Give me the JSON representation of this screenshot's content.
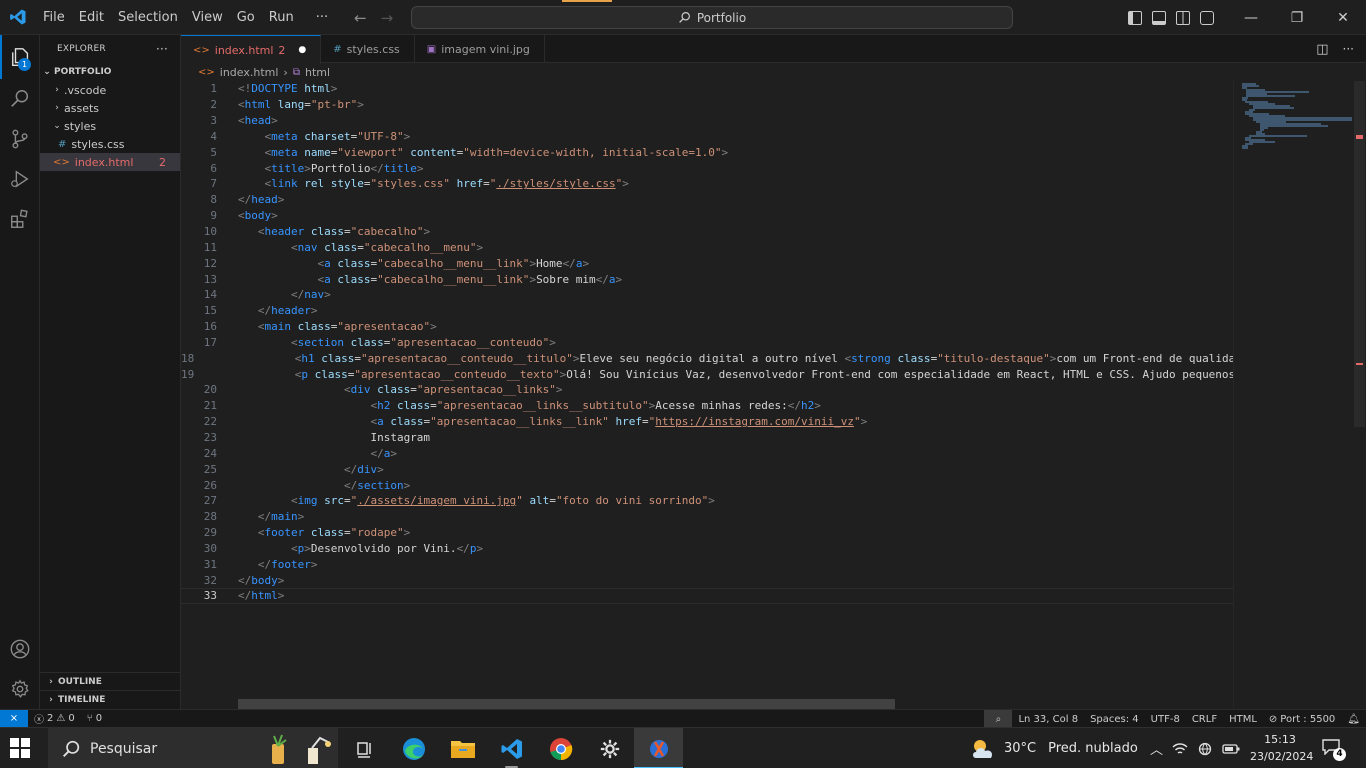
{
  "titlebar": {
    "menu": [
      "File",
      "Edit",
      "Selection",
      "View",
      "Go",
      "Run"
    ],
    "more": "···",
    "search_text": "Portfolio"
  },
  "activity": {
    "explorer_badge": "1"
  },
  "sidebar": {
    "title": "EXPLORER",
    "more": "···",
    "root": "PORTFOLIO",
    "items": [
      {
        "label": ".vscode",
        "type": "folder",
        "expanded": false,
        "indent": 1
      },
      {
        "label": "assets",
        "type": "folder",
        "expanded": false,
        "indent": 1
      },
      {
        "label": "styles",
        "type": "folder",
        "expanded": true,
        "indent": 1
      },
      {
        "label": "styles.css",
        "type": "css",
        "indent": 2
      },
      {
        "label": "index.html",
        "type": "html",
        "indent": 1,
        "selected": true,
        "errors": "2"
      }
    ],
    "outline": "OUTLINE",
    "timeline": "TIMELINE"
  },
  "tabs": [
    {
      "label": "index.html",
      "count": "2",
      "active": true,
      "modified": true,
      "icon": "html"
    },
    {
      "label": "styles.css",
      "active": false,
      "icon": "css"
    },
    {
      "label": "imagem vini.jpg",
      "active": false,
      "icon": "image"
    }
  ],
  "breadcrumb": {
    "file": "index.html",
    "symbol": "html"
  },
  "code_lines": [
    [
      [
        "tb",
        "<!"
      ],
      [
        "t",
        "DOCTYPE"
      ],
      [
        "x",
        " "
      ],
      [
        "a",
        "html"
      ],
      [
        "tb",
        ">"
      ]
    ],
    [
      [
        "tb",
        "<"
      ],
      [
        "t",
        "html"
      ],
      [
        "x",
        " "
      ],
      [
        "a",
        "lang"
      ],
      [
        "x",
        "="
      ],
      [
        "s",
        "\"pt-br\""
      ],
      [
        "tb",
        ">"
      ]
    ],
    [
      [
        "tb",
        "<"
      ],
      [
        "t",
        "head"
      ],
      [
        "tb",
        ">"
      ]
    ],
    [
      [
        "x",
        "    "
      ],
      [
        "tb",
        "<"
      ],
      [
        "t",
        "meta"
      ],
      [
        "x",
        " "
      ],
      [
        "a",
        "charset"
      ],
      [
        "x",
        "="
      ],
      [
        "s",
        "\"UTF-8\""
      ],
      [
        "tb",
        ">"
      ]
    ],
    [
      [
        "x",
        "    "
      ],
      [
        "tb",
        "<"
      ],
      [
        "t",
        "meta"
      ],
      [
        "x",
        " "
      ],
      [
        "a",
        "name"
      ],
      [
        "x",
        "="
      ],
      [
        "s",
        "\"viewport\""
      ],
      [
        "x",
        " "
      ],
      [
        "a",
        "content"
      ],
      [
        "x",
        "="
      ],
      [
        "s",
        "\"width=device-width, initial-scale=1.0\""
      ],
      [
        "tb",
        ">"
      ]
    ],
    [
      [
        "x",
        "    "
      ],
      [
        "tb",
        "<"
      ],
      [
        "t",
        "title"
      ],
      [
        "tb",
        ">"
      ],
      [
        "x",
        "Portfolio"
      ],
      [
        "tb",
        "</"
      ],
      [
        "t",
        "title"
      ],
      [
        "tb",
        ">"
      ]
    ],
    [
      [
        "x",
        "    "
      ],
      [
        "tb",
        "<"
      ],
      [
        "t",
        "link"
      ],
      [
        "x",
        " "
      ],
      [
        "a",
        "rel"
      ],
      [
        "x",
        " "
      ],
      [
        "a",
        "style"
      ],
      [
        "x",
        "="
      ],
      [
        "s",
        "\"styles.css\""
      ],
      [
        "x",
        " "
      ],
      [
        "a",
        "href"
      ],
      [
        "x",
        "="
      ],
      [
        "s",
        "\""
      ],
      [
        "su",
        "./styles/style.css"
      ],
      [
        "s",
        "\""
      ],
      [
        "tb",
        ">"
      ]
    ],
    [
      [
        "tb",
        "</"
      ],
      [
        "t",
        "head"
      ],
      [
        "tb",
        ">"
      ]
    ],
    [
      [
        "tb",
        "<"
      ],
      [
        "t",
        "body"
      ],
      [
        "tb",
        ">"
      ]
    ],
    [
      [
        "x",
        "   "
      ],
      [
        "tb",
        "<"
      ],
      [
        "t",
        "header"
      ],
      [
        "x",
        " "
      ],
      [
        "a",
        "class"
      ],
      [
        "x",
        "="
      ],
      [
        "s",
        "\"cabecalho\""
      ],
      [
        "tb",
        ">"
      ]
    ],
    [
      [
        "x",
        "        "
      ],
      [
        "tb",
        "<"
      ],
      [
        "t",
        "nav"
      ],
      [
        "x",
        " "
      ],
      [
        "a",
        "class"
      ],
      [
        "x",
        "="
      ],
      [
        "s",
        "\"cabecalho__menu\""
      ],
      [
        "tb",
        ">"
      ]
    ],
    [
      [
        "x",
        "            "
      ],
      [
        "tb",
        "<"
      ],
      [
        "t",
        "a"
      ],
      [
        "x",
        " "
      ],
      [
        "a",
        "class"
      ],
      [
        "x",
        "="
      ],
      [
        "s",
        "\"cabecalho__menu__link\""
      ],
      [
        "tb",
        ">"
      ],
      [
        "x",
        "Home"
      ],
      [
        "tb",
        "</"
      ],
      [
        "t",
        "a"
      ],
      [
        "tb",
        ">"
      ]
    ],
    [
      [
        "x",
        "            "
      ],
      [
        "tb",
        "<"
      ],
      [
        "t",
        "a"
      ],
      [
        "x",
        " "
      ],
      [
        "a",
        "class"
      ],
      [
        "x",
        "="
      ],
      [
        "s",
        "\"cabecalho__menu__link\""
      ],
      [
        "tb",
        ">"
      ],
      [
        "x",
        "Sobre mim"
      ],
      [
        "tb",
        "</"
      ],
      [
        "t",
        "a"
      ],
      [
        "tb",
        ">"
      ]
    ],
    [
      [
        "x",
        "        "
      ],
      [
        "tb",
        "</"
      ],
      [
        "t",
        "nav"
      ],
      [
        "tb",
        ">"
      ]
    ],
    [
      [
        "x",
        "   "
      ],
      [
        "tb",
        "</"
      ],
      [
        "t",
        "header"
      ],
      [
        "tb",
        ">"
      ]
    ],
    [
      [
        "x",
        "   "
      ],
      [
        "tb",
        "<"
      ],
      [
        "t",
        "main"
      ],
      [
        "x",
        " "
      ],
      [
        "a",
        "class"
      ],
      [
        "x",
        "="
      ],
      [
        "s",
        "\"apresentacao\""
      ],
      [
        "tb",
        ">"
      ]
    ],
    [
      [
        "x",
        "        "
      ],
      [
        "tb",
        "<"
      ],
      [
        "t",
        "section"
      ],
      [
        "x",
        " "
      ],
      [
        "a",
        "class"
      ],
      [
        "x",
        "="
      ],
      [
        "s",
        "\"apresentacao__conteudo\""
      ],
      [
        "tb",
        ">"
      ]
    ],
    [
      [
        "x",
        "            "
      ],
      [
        "tb",
        "<"
      ],
      [
        "t",
        "h1"
      ],
      [
        "x",
        " "
      ],
      [
        "a",
        "class"
      ],
      [
        "x",
        "="
      ],
      [
        "s",
        "\"apresentacao__conteudo__titulo\""
      ],
      [
        "tb",
        ">"
      ],
      [
        "x",
        "Eleve seu negócio digital a outro nível "
      ],
      [
        "tb",
        "<"
      ],
      [
        "t",
        "strong"
      ],
      [
        "x",
        " "
      ],
      [
        "a",
        "class"
      ],
      [
        "x",
        "="
      ],
      [
        "s",
        "\"titulo-destaque\""
      ],
      [
        "tb",
        ">"
      ],
      [
        "x",
        "com um Front-end de qualidade"
      ]
    ],
    [
      [
        "x",
        "            "
      ],
      [
        "tb",
        "<"
      ],
      [
        "t",
        "p"
      ],
      [
        "x",
        " "
      ],
      [
        "a",
        "class"
      ],
      [
        "x",
        "="
      ],
      [
        "s",
        "\"apresentacao__conteudo__texto\""
      ],
      [
        "tb",
        ">"
      ],
      [
        "x",
        "Olá! Sou Vinícius Vaz, desenvolvedor Front-end com especialidade em React, HTML e CSS. Ajudo pequenos n"
      ]
    ],
    [
      [
        "x",
        "                "
      ],
      [
        "tb",
        "<"
      ],
      [
        "t",
        "div"
      ],
      [
        "x",
        " "
      ],
      [
        "a",
        "class"
      ],
      [
        "x",
        "="
      ],
      [
        "s",
        "\"apresentacao__links\""
      ],
      [
        "tb",
        ">"
      ]
    ],
    [
      [
        "x",
        "                    "
      ],
      [
        "tb",
        "<"
      ],
      [
        "t",
        "h2"
      ],
      [
        "x",
        " "
      ],
      [
        "a",
        "class"
      ],
      [
        "x",
        "="
      ],
      [
        "s",
        "\"apresentacao__links__subtitulo\""
      ],
      [
        "tb",
        ">"
      ],
      [
        "x",
        "Acesse minhas redes:"
      ],
      [
        "tb",
        "</"
      ],
      [
        "t",
        "h2"
      ],
      [
        "tb",
        ">"
      ]
    ],
    [
      [
        "x",
        "                    "
      ],
      [
        "tb",
        "<"
      ],
      [
        "t",
        "a"
      ],
      [
        "x",
        " "
      ],
      [
        "a",
        "class"
      ],
      [
        "x",
        "="
      ],
      [
        "s",
        "\"apresentacao__links__link\""
      ],
      [
        "x",
        " "
      ],
      [
        "a",
        "href"
      ],
      [
        "x",
        "="
      ],
      [
        "s",
        "\""
      ],
      [
        "su",
        "https://instagram.com/vinii_vz"
      ],
      [
        "s",
        "\""
      ],
      [
        "tb",
        ">"
      ]
    ],
    [
      [
        "x",
        "                    Instagram"
      ]
    ],
    [
      [
        "x",
        "                    "
      ],
      [
        "tb",
        "</"
      ],
      [
        "t",
        "a"
      ],
      [
        "tb",
        ">"
      ]
    ],
    [
      [
        "x",
        "                "
      ],
      [
        "tb",
        "</"
      ],
      [
        "t",
        "div"
      ],
      [
        "tb",
        ">"
      ]
    ],
    [
      [
        "x",
        "                "
      ],
      [
        "tb",
        "</"
      ],
      [
        "t",
        "section"
      ],
      [
        "tb",
        ">"
      ]
    ],
    [
      [
        "x",
        "        "
      ],
      [
        "tb",
        "<"
      ],
      [
        "t",
        "img"
      ],
      [
        "x",
        " "
      ],
      [
        "a",
        "src"
      ],
      [
        "x",
        "="
      ],
      [
        "s",
        "\""
      ],
      [
        "su",
        "./assets/imagem vini.jpg"
      ],
      [
        "s",
        "\""
      ],
      [
        "x",
        " "
      ],
      [
        "a",
        "alt"
      ],
      [
        "x",
        "="
      ],
      [
        "s",
        "\"foto do vini sorrindo\""
      ],
      [
        "tb",
        ">"
      ]
    ],
    [
      [
        "x",
        "   "
      ],
      [
        "tb",
        "</"
      ],
      [
        "t",
        "main"
      ],
      [
        "tb",
        ">"
      ]
    ],
    [
      [
        "x",
        "   "
      ],
      [
        "tb",
        "<"
      ],
      [
        "t",
        "footer"
      ],
      [
        "x",
        " "
      ],
      [
        "a",
        "class"
      ],
      [
        "x",
        "="
      ],
      [
        "s",
        "\"rodape\""
      ],
      [
        "tb",
        ">"
      ]
    ],
    [
      [
        "x",
        "        "
      ],
      [
        "tb",
        "<"
      ],
      [
        "t",
        "p"
      ],
      [
        "tb",
        ">"
      ],
      [
        "x",
        "Desenvolvido por Vini."
      ],
      [
        "tb",
        "</"
      ],
      [
        "t",
        "p"
      ],
      [
        "tb",
        ">"
      ]
    ],
    [
      [
        "x",
        "   "
      ],
      [
        "tb",
        "</"
      ],
      [
        "t",
        "footer"
      ],
      [
        "tb",
        ">"
      ]
    ],
    [
      [
        "tb",
        "</"
      ],
      [
        "t",
        "body"
      ],
      [
        "tb",
        ">"
      ]
    ],
    [
      [
        "tb",
        "</"
      ],
      [
        "t",
        "html"
      ],
      [
        "tb",
        ">"
      ]
    ]
  ],
  "statusbar": {
    "errors": "2",
    "warnings": "0",
    "ports": "0",
    "position": "Ln 33, Col 8",
    "spaces": "Spaces: 4",
    "encoding": "UTF-8",
    "eol": "CRLF",
    "language": "HTML",
    "port": "Port : 5500"
  },
  "taskbar": {
    "search_text": "Pesquisar",
    "weather_temp": "30°C",
    "weather_desc": "Pred. nublado",
    "time": "15:13",
    "date": "23/02/2024",
    "notification_count": "4"
  },
  "colors": {
    "accent": "#0078d4",
    "error": "#e56b6b",
    "tag": "#3794ff",
    "attribute": "#9cdcfe",
    "string": "#ce9178"
  }
}
